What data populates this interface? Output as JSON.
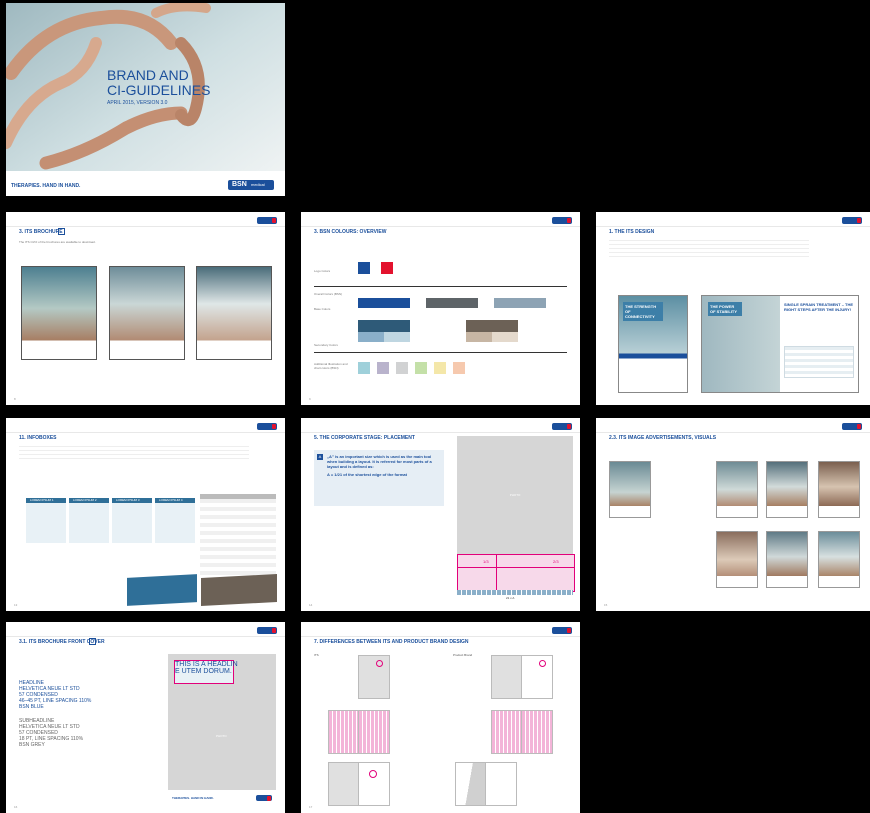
{
  "cover": {
    "title_line1": "BRAND AND",
    "title_line2": "CI-GUIDELINES",
    "subtitle": "APRIL 2015, VERSION 3.0",
    "tagline": "THERAPIES. HAND IN HAND.",
    "logo_text": "BSN",
    "logo_sub": "medical",
    "accent": "#1b4f9b",
    "red": "#e3122e"
  },
  "pages": [
    {
      "title": "3. ITS BROCHURE",
      "num": "8",
      "text": "The ITS CI/CI of the brochures are available to download."
    },
    {
      "title": "3. BSN COLOURS: OVERVIEW",
      "num": "9",
      "rows": [
        "Logo Colors",
        "Overall Colors (BSN)",
        "Base Colors",
        "Secondary Colors",
        "Additional Illustration and chart colors (BSN)"
      ],
      "colors": [
        "#1b4f9b",
        "#e3122e",
        "#1b4f9b",
        "#5e6468",
        "#8da3b4",
        "#2e5a78",
        "#8aafc9",
        "#6c6156",
        "#c7b6a4",
        "#bfd6e1",
        "#9fd0da",
        "#b9b3cc",
        "#d1d2d3",
        "#c4e0a8",
        "#f4e7a9",
        "#f6c9ae"
      ]
    },
    {
      "title": "1. THE ITS DESIGN",
      "num": "10",
      "box1": "THE STRENGTH OF CONNECTIVITY",
      "box2": "THE POWER OF STABILITY",
      "box3": "SINGLE SPRAIN TREATMENT – THE RIGHT STEPS AFTER THE INJURY!"
    },
    {
      "title": "11. INFOBOXES",
      "num": "13",
      "tabs": [
        "LOREM IPSUM 1",
        "LOREM IPSUM 2",
        "LOREM IPSUM 3",
        "LOREM IPSUM 4"
      ]
    },
    {
      "title": "5. THE CORPORATE STAGE: PLACEMENT",
      "num": "14",
      "callout": "„A” is an important size which is used as the main tool when building a layout. It is referred for most parts of a layout and is defined as:",
      "formula": "A = 1/21 of the shortest edge of the format",
      "ratio1": "1/3",
      "ratio2": "2/3",
      "placeholder": "PHOTO",
      "scale": "21 x A"
    },
    {
      "title": "2.3. ITS IMAGE ADVERTISEMENTS, VISUALS",
      "num": "15"
    },
    {
      "title": "3.1. ITS BROCHURE FRONT COVER",
      "num": "16",
      "h1": "HEADLINE",
      "h2": "HELVETICA NEUE LT STD",
      "h3": "57 CONDENSED",
      "h4": "46–45 PT, LINE SPACING 110%",
      "h5": "BSN BLUE",
      "s1": "SUBHEADLINE",
      "s2": "HELVETICA NEUE LT STD",
      "s3": "57 CONDENSED",
      "s4": "18 PT, LINE SPACING 110%",
      "s5": "BSN GREY",
      "headline1": "THIS IS A HEADLIN",
      "headline2": "E UTEM DORUM.",
      "foot": "THERAPIES. HAND IN HAND.",
      "placeholder": "PHOTO"
    },
    {
      "title": "7. DIFFERENCES BETWEEN ITS AND PRODUCT BRAND DESIGN",
      "num": "17",
      "col1": "ITS",
      "col2": "Product Brand",
      "placeholder": "PHOTO"
    }
  ]
}
